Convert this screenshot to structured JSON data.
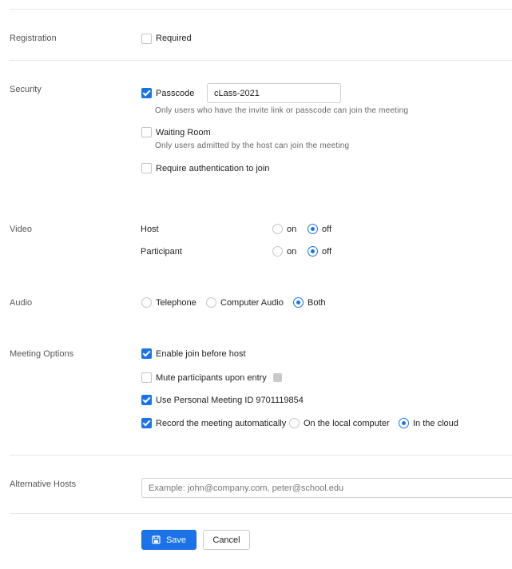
{
  "registration": {
    "label": "Registration",
    "required_label": "Required",
    "required_checked": false
  },
  "security": {
    "label": "Security",
    "passcode_label": "Passcode",
    "passcode_checked": true,
    "passcode_value": "cLass-2021",
    "passcode_hint": "Only users who have the invite link or passcode can join the meeting",
    "waiting_room_label": "Waiting Room",
    "waiting_room_checked": false,
    "waiting_room_hint": "Only users admitted by the host can join the meeting",
    "auth_label": "Require authentication to join",
    "auth_checked": false
  },
  "video": {
    "label": "Video",
    "host_label": "Host",
    "participant_label": "Participant",
    "on_label": "on",
    "off_label": "off",
    "host_value": "off",
    "participant_value": "off"
  },
  "audio": {
    "label": "Audio",
    "options": [
      "Telephone",
      "Computer Audio",
      "Both"
    ],
    "selected": "Both"
  },
  "meeting_options": {
    "label": "Meeting Options",
    "join_before_host_label": "Enable join before host",
    "join_before_host_checked": true,
    "mute_label": "Mute participants upon entry",
    "mute_checked": false,
    "pmi_label": "Use Personal Meeting ID 9701119854",
    "pmi_checked": true,
    "record_label": "Record the meeting automatically",
    "record_checked": true,
    "record_local_label": "On the local computer",
    "record_cloud_label": "In the cloud",
    "record_location": "cloud",
    "info_icon": "info-icon"
  },
  "alternative_hosts": {
    "label": "Alternative Hosts",
    "placeholder": "Example: john@company.com, peter@school.edu",
    "value": ""
  },
  "actions": {
    "save_label": "Save",
    "save_icon": "save-icon",
    "cancel_label": "Cancel"
  },
  "colors": {
    "accent": "#1a73e8",
    "border": "#c4c4c4",
    "divider": "#e6e6e6"
  }
}
